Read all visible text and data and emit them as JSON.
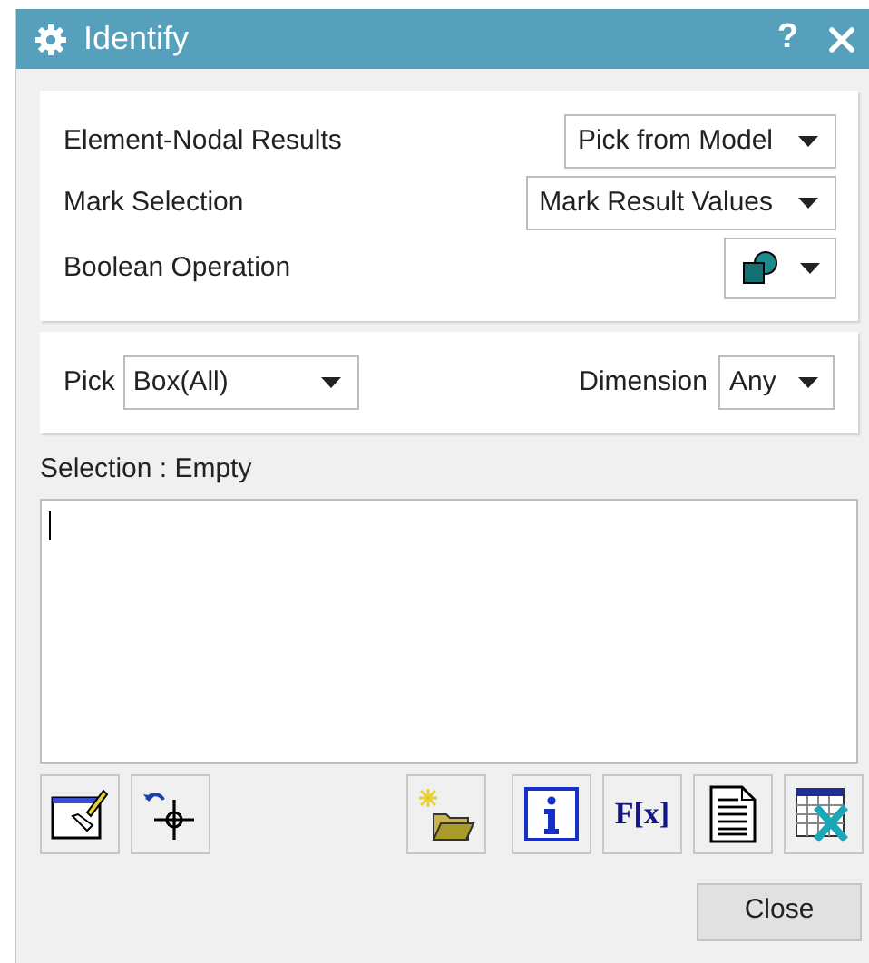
{
  "window": {
    "title": "Identify",
    "help": "?"
  },
  "settings": [
    {
      "label": "Element-Nodal Results",
      "kind": "dropdown",
      "value": "Pick from Model"
    },
    {
      "label": "Mark Selection",
      "kind": "dropdown",
      "value": "Mark Result Values"
    },
    {
      "label": "Boolean Operation",
      "kind": "icon_dropdown"
    }
  ],
  "pick": {
    "label": "Pick",
    "value": "Box(All)"
  },
  "dimension": {
    "label": "Dimension",
    "value": "Any"
  },
  "selection": {
    "label": "Selection : Empty"
  },
  "tool_groups": [
    {
      "tools": [
        {
          "kind": "paint"
        },
        {
          "kind": "crosshair"
        }
      ]
    },
    {
      "tools": [
        {
          "kind": "folder"
        }
      ]
    },
    {
      "tools": [
        {
          "kind": "info"
        },
        {
          "kind": "text",
          "text": "F[x]"
        },
        {
          "kind": "document"
        },
        {
          "kind": "spreadsheet"
        }
      ]
    }
  ],
  "close_button": "Close"
}
